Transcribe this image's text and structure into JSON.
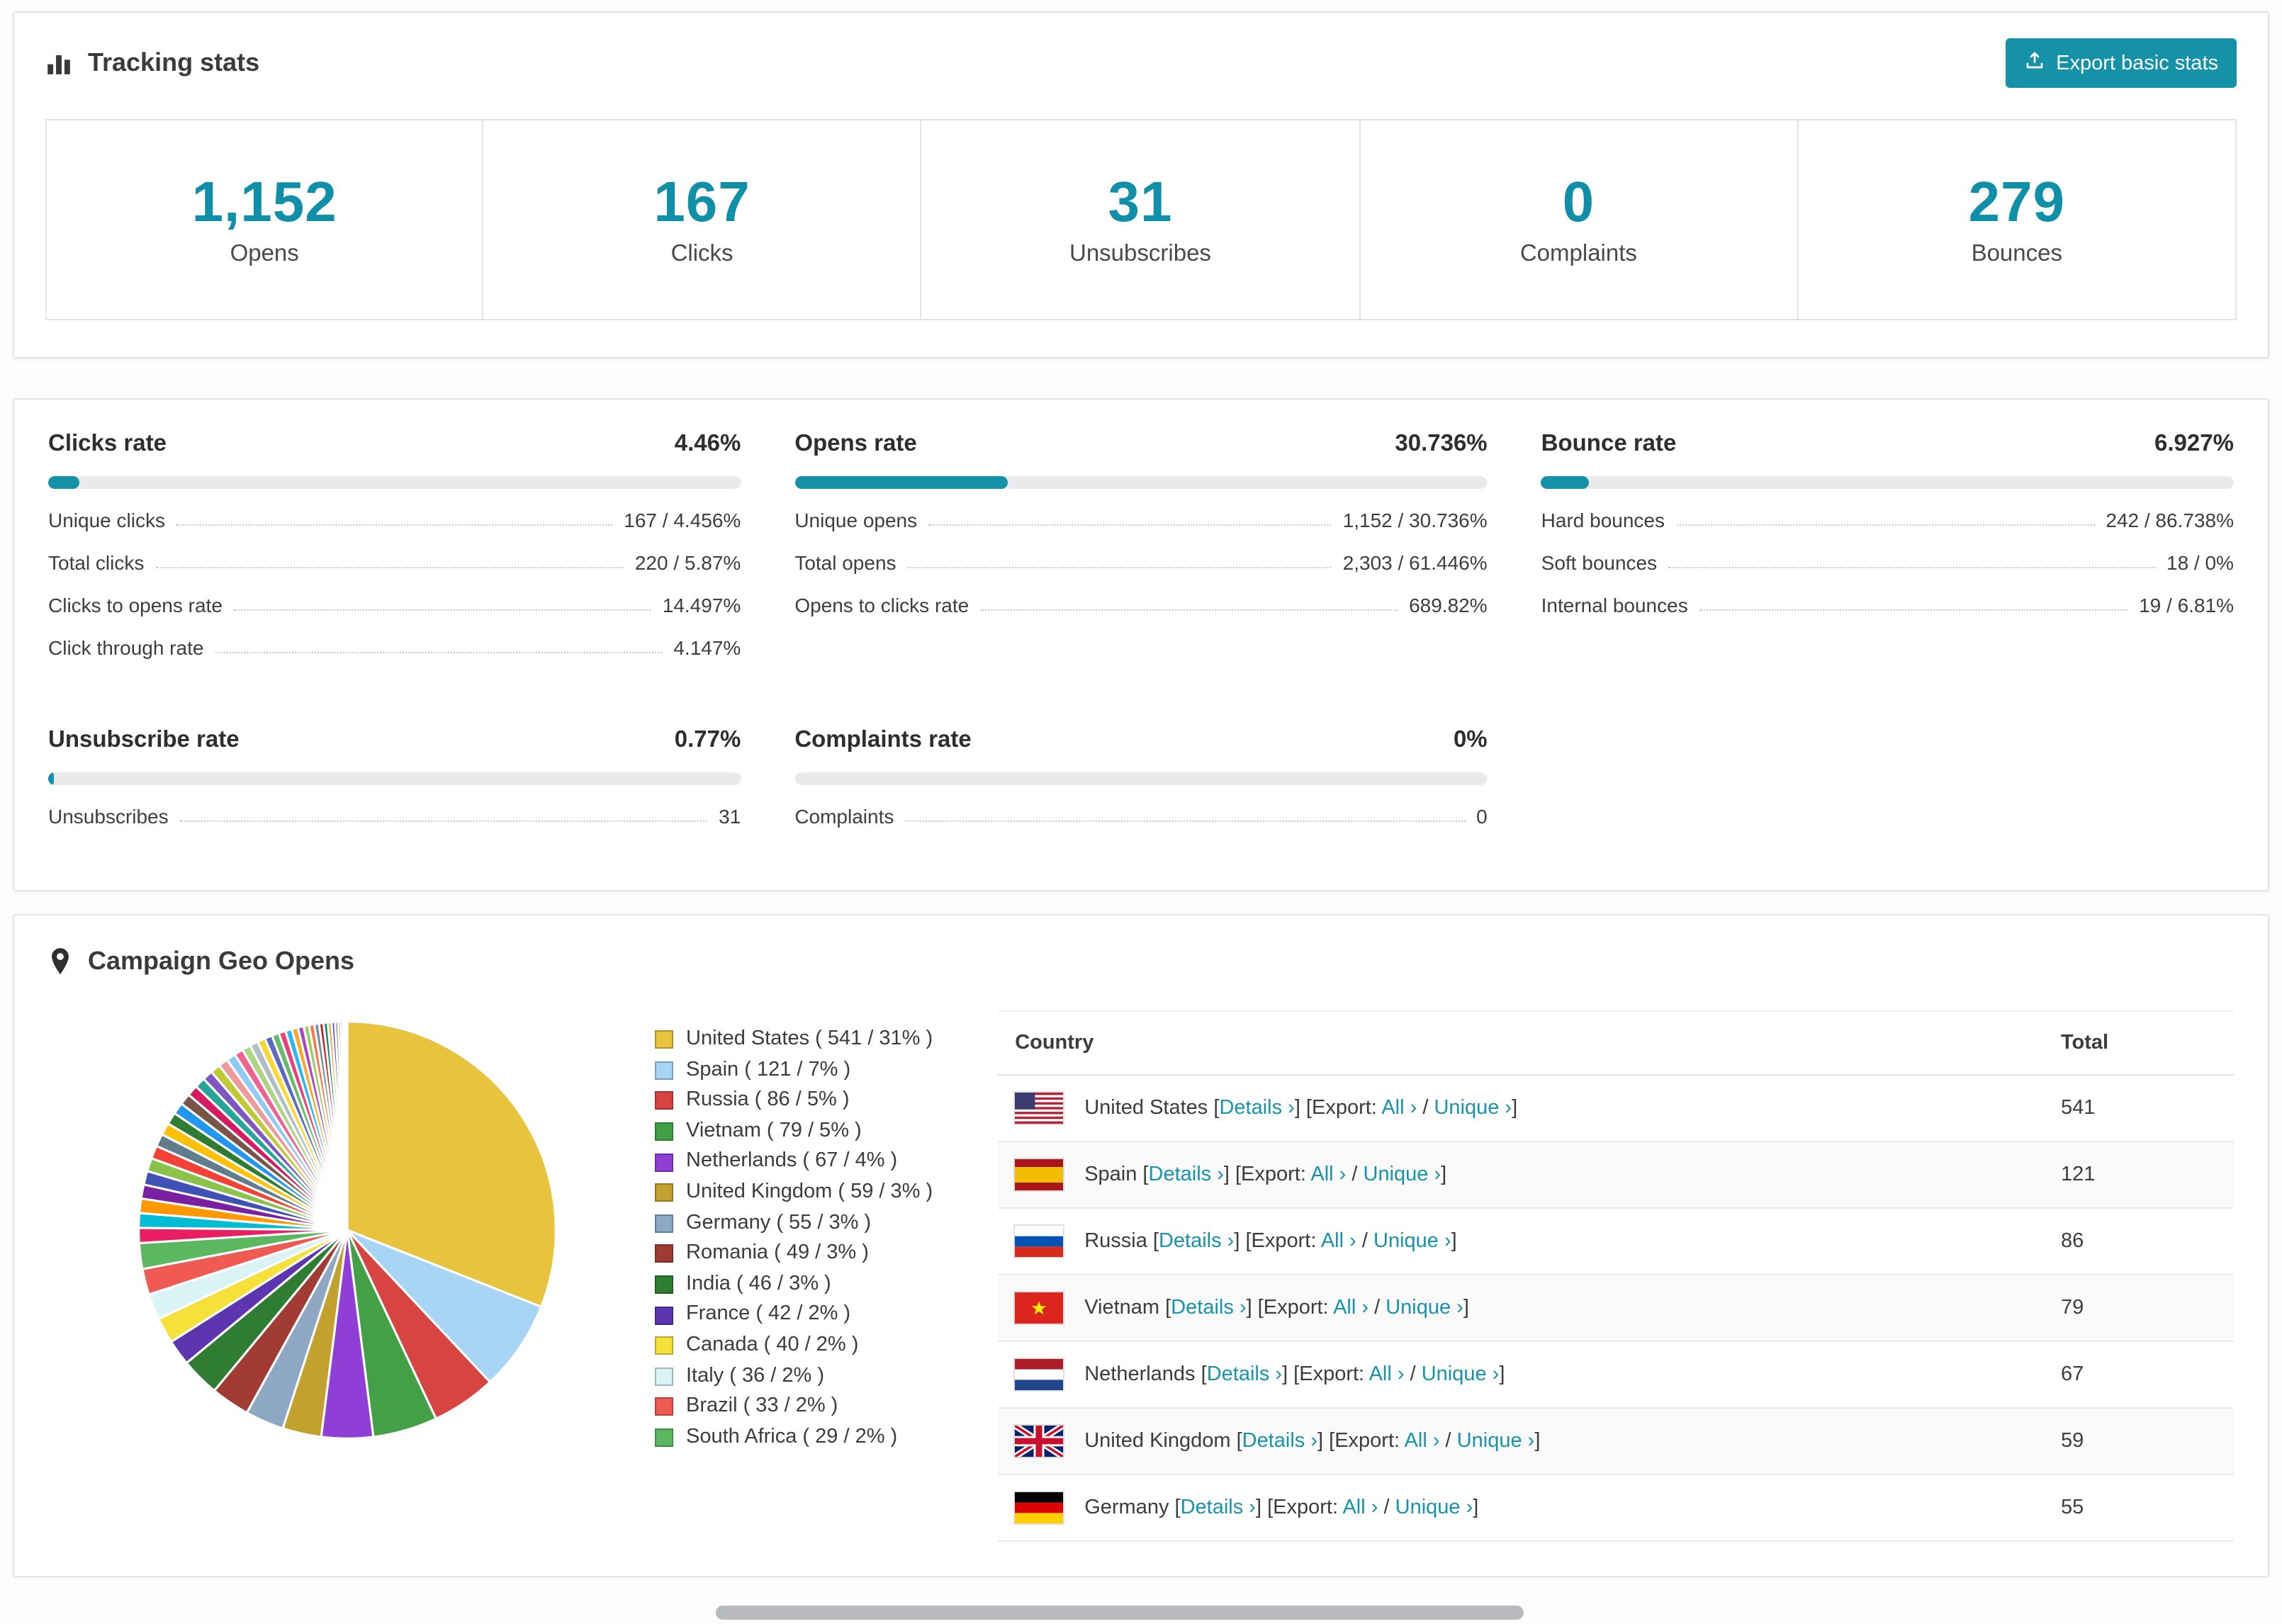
{
  "accent": "#1591a8",
  "tracking": {
    "title": "Tracking stats",
    "export_button": "Export basic stats",
    "stats": [
      {
        "value": "1,152",
        "label": "Opens"
      },
      {
        "value": "167",
        "label": "Clicks"
      },
      {
        "value": "31",
        "label": "Unsubscribes"
      },
      {
        "value": "0",
        "label": "Complaints"
      },
      {
        "value": "279",
        "label": "Bounces"
      }
    ]
  },
  "rates": [
    {
      "title": "Clicks rate",
      "percent_label": "4.46%",
      "bar_percent": 4.46,
      "rows": [
        {
          "label": "Unique clicks",
          "value": "167 / 4.456%"
        },
        {
          "label": "Total clicks",
          "value": "220 / 5.87%"
        },
        {
          "label": "Clicks to opens rate",
          "value": "14.497%"
        },
        {
          "label": "Click through rate",
          "value": "4.147%"
        }
      ]
    },
    {
      "title": "Opens rate",
      "percent_label": "30.736%",
      "bar_percent": 30.736,
      "rows": [
        {
          "label": "Unique opens",
          "value": "1,152 / 30.736%"
        },
        {
          "label": "Total opens",
          "value": "2,303 / 61.446%"
        },
        {
          "label": "Opens to clicks rate",
          "value": "689.82%"
        }
      ]
    },
    {
      "title": "Bounce rate",
      "percent_label": "6.927%",
      "bar_percent": 6.927,
      "rows": [
        {
          "label": "Hard bounces",
          "value": "242 / 86.738%"
        },
        {
          "label": "Soft bounces",
          "value": "18 / 0%"
        },
        {
          "label": "Internal bounces",
          "value": "19 / 6.81%"
        }
      ]
    },
    {
      "title": "Unsubscribe rate",
      "percent_label": "0.77%",
      "bar_percent": 0.77,
      "rows": [
        {
          "label": "Unsubscribes",
          "value": "31"
        }
      ]
    },
    {
      "title": "Complaints rate",
      "percent_label": "0%",
      "bar_percent": 0,
      "rows": [
        {
          "label": "Complaints",
          "value": "0"
        }
      ]
    }
  ],
  "geo": {
    "title": "Campaign Geo Opens",
    "table": {
      "headers": {
        "country": "Country",
        "total": "Total"
      },
      "link_labels": {
        "details": "Details",
        "export_prefix": "Export:",
        "all": "All",
        "unique": "Unique",
        "chevron": "›"
      },
      "rows": [
        {
          "country": "United States",
          "flag": "us",
          "total": "541"
        },
        {
          "country": "Spain",
          "flag": "es",
          "total": "121"
        },
        {
          "country": "Russia",
          "flag": "ru",
          "total": "86"
        },
        {
          "country": "Vietnam",
          "flag": "vn",
          "total": "79"
        },
        {
          "country": "Netherlands",
          "flag": "nl",
          "total": "67"
        },
        {
          "country": "United Kingdom",
          "flag": "gb",
          "total": "59"
        },
        {
          "country": "Germany",
          "flag": "de",
          "total": "55"
        }
      ]
    }
  },
  "chart_data": {
    "type": "pie",
    "title": "Campaign Geo Opens",
    "legend_position": "right",
    "slices": [
      {
        "label": "United States",
        "value": 541,
        "percent": 31,
        "color": "#e8c33d"
      },
      {
        "label": "Spain",
        "value": 121,
        "percent": 7,
        "color": "#a9d5f5"
      },
      {
        "label": "Russia",
        "value": 86,
        "percent": 5,
        "color": "#d64541"
      },
      {
        "label": "Vietnam",
        "value": 79,
        "percent": 5,
        "color": "#43a047"
      },
      {
        "label": "Netherlands",
        "value": 67,
        "percent": 4,
        "color": "#8f3fd6"
      },
      {
        "label": "United Kingdom",
        "value": 59,
        "percent": 3,
        "color": "#c3a12f"
      },
      {
        "label": "Germany",
        "value": 55,
        "percent": 3,
        "color": "#8ea8c3"
      },
      {
        "label": "Romania",
        "value": 49,
        "percent": 3,
        "color": "#a03c33"
      },
      {
        "label": "India",
        "value": 46,
        "percent": 3,
        "color": "#2e7d32"
      },
      {
        "label": "France",
        "value": 42,
        "percent": 2,
        "color": "#5e35b1"
      },
      {
        "label": "Canada",
        "value": 40,
        "percent": 2,
        "color": "#f6e13a"
      },
      {
        "label": "Italy",
        "value": 36,
        "percent": 2,
        "color": "#daf3f6"
      },
      {
        "label": "Brazil",
        "value": 33,
        "percent": 2,
        "color": "#ef5a52"
      },
      {
        "label": "South Africa",
        "value": 29,
        "percent": 2,
        "color": "#5cb860"
      }
    ],
    "others": {
      "percent_total": 26,
      "slice_count": 40,
      "colors": [
        "#e91e63",
        "#00bcd4",
        "#ff9800",
        "#7b1fa2",
        "#3f51b5",
        "#8bc34a",
        "#f44336",
        "#607d8b",
        "#ffc107",
        "#2e7d32",
        "#2196f3",
        "#795548",
        "#d81b60",
        "#26a69a",
        "#7e57c2",
        "#c0ca33",
        "#ef9a9a",
        "#90caf9",
        "#f06292",
        "#aed581",
        "#b0bec5",
        "#fdd835",
        "#5c6bc0",
        "#66bb6a",
        "#ec407a",
        "#29b6f6",
        "#ffa726",
        "#ab47bc",
        "#9ccc65",
        "#ff7043",
        "#78909c",
        "#c62828",
        "#00897b",
        "#f9a825",
        "#673ab7",
        "#43a047",
        "#e57373",
        "#64b5f6",
        "#f48fb1",
        "#81c784"
      ]
    }
  }
}
